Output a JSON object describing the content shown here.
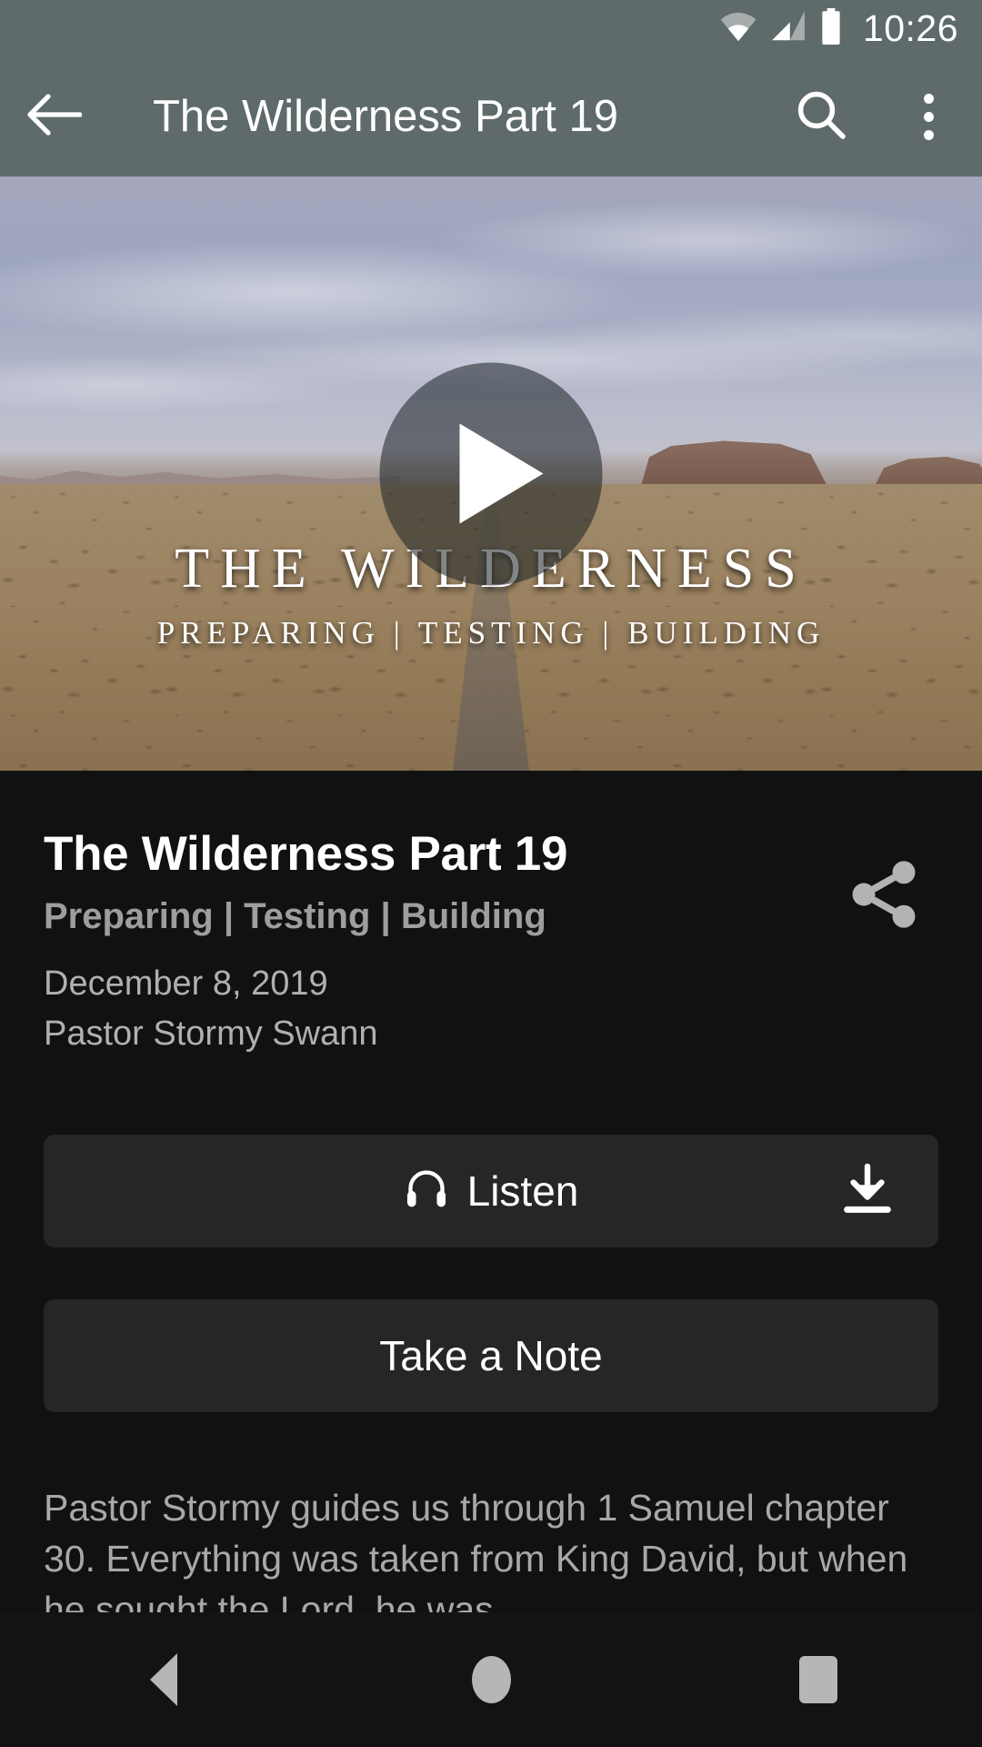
{
  "status_bar": {
    "time": "10:26",
    "icons": [
      "wifi-icon",
      "cellular-signal-icon",
      "battery-icon"
    ]
  },
  "app_bar": {
    "back_icon": "arrow-back-icon",
    "title": "The Wilderness Part 19",
    "search_icon": "search-icon",
    "overflow_icon": "more-vertical-icon"
  },
  "video": {
    "play_icon": "play-icon",
    "overlay_title": "THE WILDERNESS",
    "overlay_subtitle": "PREPARING | TESTING | BUILDING"
  },
  "sermon": {
    "title": "The Wilderness Part 19",
    "subtitle": "Preparing | Testing | Building",
    "date": "December 8, 2019",
    "speaker": "Pastor Stormy Swann",
    "share_icon": "share-icon",
    "description": "Pastor Stormy guides us through 1 Samuel chapter 30. Everything was taken from King David, but when he sought the Lord, he was"
  },
  "actions": {
    "listen_label": "Listen",
    "listen_icon": "headphones-icon",
    "download_icon": "download-icon",
    "note_label": "Take a Note"
  },
  "nav_bar": {
    "back_label": "back-icon",
    "home_label": "home-icon",
    "recents_label": "recents-icon"
  },
  "colors": {
    "app_bar": "#5f6a6a",
    "background": "#111111",
    "button": "#262626",
    "text_primary": "#ffffff",
    "text_secondary": "#a8a8a8"
  }
}
